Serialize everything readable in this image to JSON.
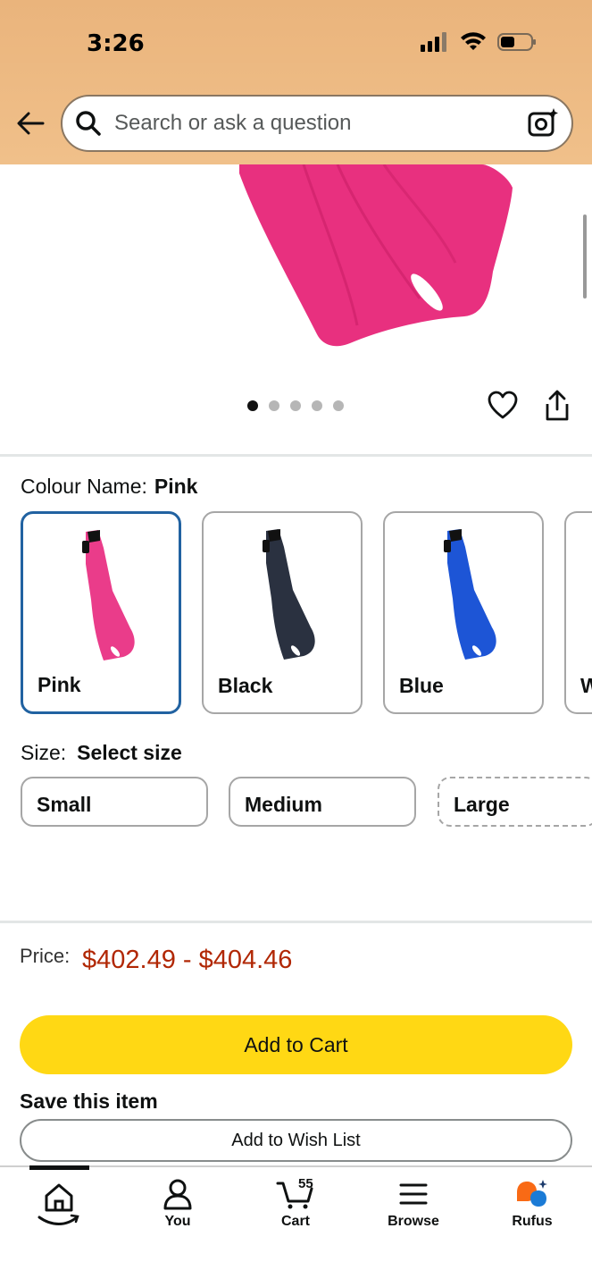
{
  "status_bar": {
    "time": "3:26"
  },
  "search": {
    "placeholder": "Search or ask a question"
  },
  "carousel": {
    "total": 5,
    "active_index": 0
  },
  "colour": {
    "label": "Colour Name:",
    "selected": "Pink",
    "options": [
      {
        "name": "Pink",
        "color": "#ea3c8a"
      },
      {
        "name": "Black",
        "color": "#2a3140"
      },
      {
        "name": "Blue",
        "color": "#1d55d6"
      },
      {
        "name": "W",
        "color": "#ffffff"
      }
    ]
  },
  "size": {
    "label": "Size:",
    "selected": "Select size",
    "options": [
      "Small",
      "Medium",
      "Large"
    ]
  },
  "price": {
    "label": "Price:",
    "value": "$402.49 - $404.46"
  },
  "actions": {
    "add_to_cart": "Add to Cart",
    "save_title": "Save this item",
    "add_to_wish_list": "Add to Wish List"
  },
  "nav": {
    "items": [
      {
        "label": "",
        "icon": "home-icon"
      },
      {
        "label": "You",
        "icon": "person-icon"
      },
      {
        "label": "Cart",
        "icon": "cart-icon",
        "count": "55"
      },
      {
        "label": "Browse",
        "icon": "menu-icon"
      },
      {
        "label": "Rufus",
        "icon": "rufus-icon"
      }
    ]
  },
  "colors": {
    "header": "#eab47c",
    "accent": "#2162a1",
    "price": "#b12704",
    "cart_button": "#ffd814"
  }
}
